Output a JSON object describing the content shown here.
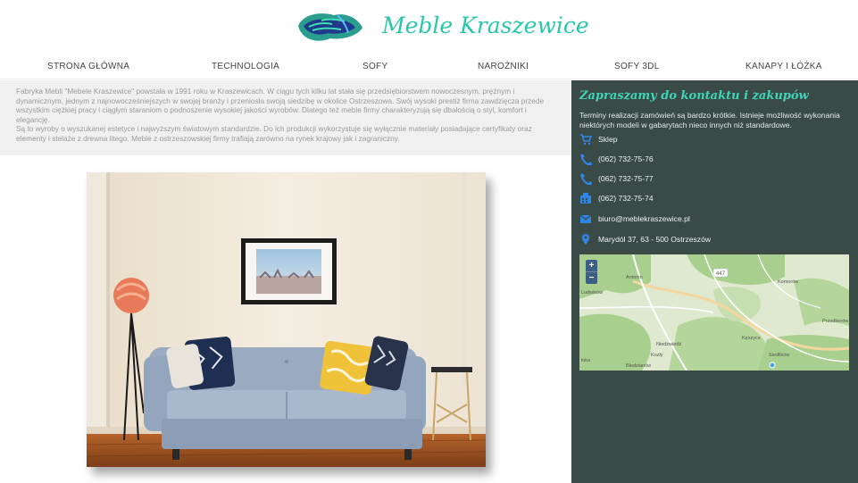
{
  "brand": {
    "name": "Meble Kraszewice"
  },
  "nav": {
    "items": [
      {
        "label": "STRONA GŁÓWNA"
      },
      {
        "label": "TECHNOLOGIA"
      },
      {
        "label": "SOFY"
      },
      {
        "label": "NAROŻNIKI"
      },
      {
        "label": "SOFY 3DL"
      },
      {
        "label": "KANAPY I ŁÓŻKA"
      }
    ]
  },
  "intro": {
    "text": "Fabryka Mebli \"Mebele Kraszewice\" powstała w 1991 roku w Kraszewicach. W ciągu tych kilku lat stała się przedsiębiorstwem nowoczesnym, prężnym i dynamicznym, jednym z najnowocześniejszych w swojej branży i przeniosła swoją siedzibę w okolice Ostrzeszowa. Swój wysoki prestiż firma zawdzięcza przede wszystkim ciężkiej pracy i ciągłym staraniom o podnoszenie wysokiej jakości wyrobów. Dlatego też meble firmy charakteryzują się dbałością o styl, komfort i elegancję.\nSą to wyroby o wyszukanej estetyce i najwyższym światowym standardzie. Do ich produkcji wykorzystuje się wyłącznie materiały posiadające certyfikaty oraz elementy i stelaże z drewna litego. Meble z ostrzeszowskiej firmy trafiają zarówno na rynek krajowy jak i zagraniczny."
  },
  "sidebar": {
    "title": "Zapraszamy do kontaktu i zakupów",
    "text": "Terminy realizacji zamówień są bardzo krótkie. Istnieje możliwość wykonania niektórych modeli w gabarytach nieco innych niż standardowe.",
    "contacts": [
      {
        "icon": "cart-icon",
        "text": "Sklep"
      },
      {
        "icon": "phone-icon",
        "text": "(062) 732-75-76"
      },
      {
        "icon": "phone-icon",
        "text": "(062) 732-75-77"
      },
      {
        "icon": "fax-icon",
        "text": "(062) 732-75-74"
      },
      {
        "icon": "envelope-icon",
        "text": "biuro@meblekraszewice.pl"
      },
      {
        "icon": "map-pin-icon",
        "text": "Marydól 37, 63 - 500 Ostrzeszów"
      }
    ],
    "map": {
      "zoom_in": "+",
      "zoom_out": "−",
      "road_label": "447",
      "places": [
        "Antonin",
        "Komorów",
        "Ludwików",
        "Przedborów",
        "Niedźwiedź",
        "Kęszyce",
        "Kozły",
        "Siedlików",
        "Bledzianów",
        "łoka"
      ]
    }
  },
  "colors": {
    "accent": "#29c7a9",
    "sidebar_bg": "#3a4a47",
    "icon_blue": "#2f86e6"
  }
}
